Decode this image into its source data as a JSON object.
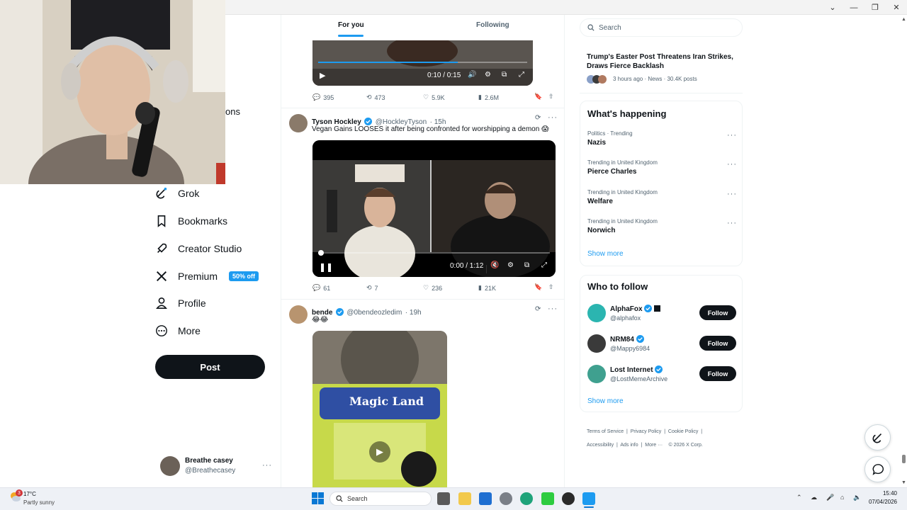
{
  "feed_tabs": {
    "for_you": "For you",
    "following": "Following"
  },
  "search": {
    "placeholder": "Search"
  },
  "nav": {
    "partial_label": "ons",
    "grok": "Grok",
    "bookmarks": "Bookmarks",
    "creator_studio": "Creator Studio",
    "premium": "Premium",
    "premium_badge": "50% off",
    "profile": "Profile",
    "more": "More",
    "post_button": "Post"
  },
  "account": {
    "name": "Breathe casey",
    "handle": "@Breathecasey"
  },
  "tweets": [
    {
      "video_time": "0:10 / 0:15",
      "replies": "395",
      "reposts": "473",
      "likes": "5.9K",
      "views": "2.6M"
    },
    {
      "name": "Tyson Hockley",
      "handle": "@HockleyTyson",
      "time": "· 15h",
      "text": "Vegan Gains LOOSES it after being confronted for worshipping a demon 😱",
      "video_time": "0:00 / 1:12",
      "replies": "61",
      "reposts": "7",
      "likes": "236",
      "views": "21K"
    },
    {
      "name": "bende",
      "handle": "@0bendeozledim",
      "time": "· 19h",
      "text": "😂😂",
      "sign_text": "Magic Land"
    }
  ],
  "news": {
    "headline": "Trump's Easter Post Threatens Iran Strikes, Draws Fierce Backlash",
    "meta": "3 hours ago · News · 30.4K posts"
  },
  "whats_happening": {
    "title": "What's happening",
    "trends": [
      {
        "category": "Politics · Trending",
        "name": "Nazis"
      },
      {
        "category": "Trending in United Kingdom",
        "name": "Pierce Charles"
      },
      {
        "category": "Trending in United Kingdom",
        "name": "Welfare"
      },
      {
        "category": "Trending in United Kingdom",
        "name": "Norwich"
      }
    ],
    "show_more": "Show more"
  },
  "who_to_follow": {
    "title": "Who to follow",
    "accounts": [
      {
        "name": "AlphaFox",
        "handle": "@alphafox"
      },
      {
        "name": "NRM84",
        "handle": "@Mappy6984"
      },
      {
        "name": "Lost Internet",
        "handle": "@LostMemeArchive"
      }
    ],
    "follow_label": "Follow",
    "show_more": "Show more"
  },
  "footer": {
    "links": [
      "Terms of Service",
      "Privacy Policy",
      "Cookie Policy",
      "Accessibility",
      "Ads info",
      "More ···",
      "© 2026 X Corp."
    ]
  },
  "taskbar": {
    "weather_temp": "17°C",
    "weather_desc": "Partly sunny",
    "weather_badge": "3",
    "search_label": "Search",
    "time": "15:40",
    "date": "07/04/2026"
  },
  "colors": {
    "accent": "#1d9bf0",
    "text": "#0f1419",
    "muted": "#536471",
    "button": "#0f1419"
  }
}
